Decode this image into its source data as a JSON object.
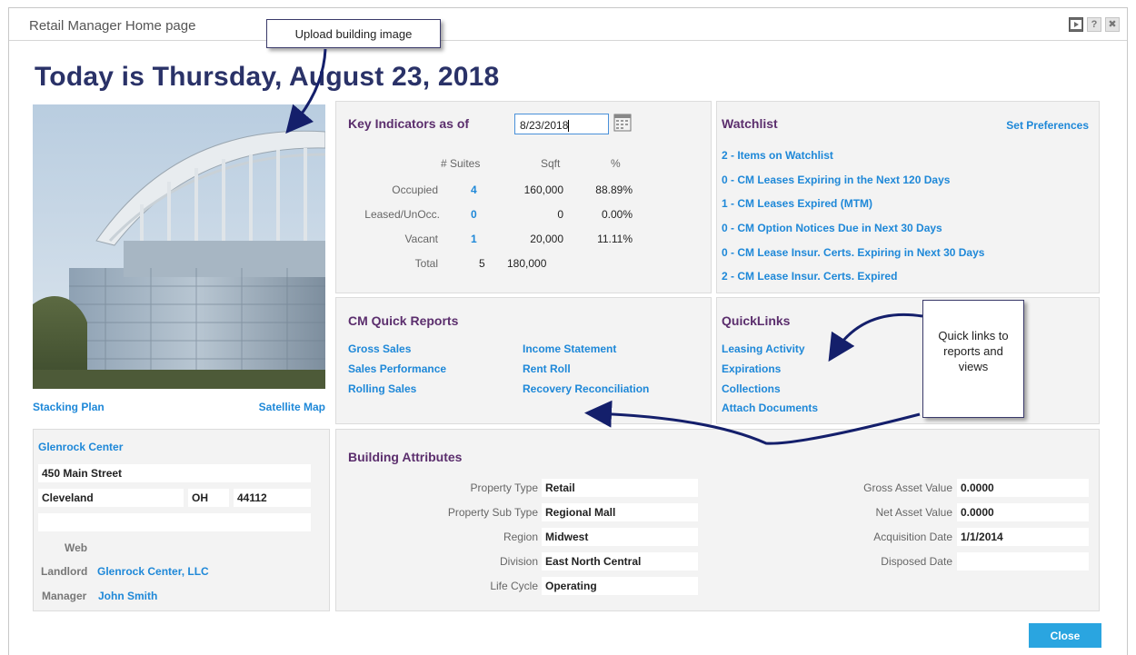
{
  "window": {
    "title": "Retail Manager Home page"
  },
  "heading": "Today is Thursday, August 23, 2018",
  "image_links": {
    "stacking_plan": "Stacking Plan",
    "satellite_map": "Satellite Map"
  },
  "key_indicators": {
    "title": "Key Indicators as of",
    "date_value": "8/23/2018",
    "columns": [
      "# Suites",
      "Sqft",
      "%"
    ],
    "rows": [
      {
        "label": "Occupied",
        "suites": "4",
        "sqft": "160,000",
        "pct": "88.89%"
      },
      {
        "label": "Leased/UnOcc.",
        "suites": "0",
        "sqft": "0",
        "pct": "0.00%"
      },
      {
        "label": "Vacant",
        "suites": "1",
        "sqft": "20,000",
        "pct": "11.11%"
      },
      {
        "label": "Total",
        "suites": "5",
        "sqft": "180,000",
        "pct": ""
      }
    ]
  },
  "watchlist": {
    "title": "Watchlist",
    "set_preferences": "Set Preferences",
    "items": [
      "2 - Items on Watchlist",
      "0 - CM Leases Expiring in the Next 120 Days",
      "1 - CM Leases Expired (MTM)",
      "0 - CM Option Notices Due in Next 30 Days",
      "0 - CM Lease Insur. Certs. Expiring in Next 30 Days",
      "2 - CM Lease Insur. Certs. Expired"
    ]
  },
  "quick_reports": {
    "title": "CM Quick Reports",
    "left": [
      "Gross Sales",
      "Sales Performance",
      "Rolling Sales"
    ],
    "right": [
      "Income Statement",
      "Rent Roll",
      "Recovery Reconciliation"
    ]
  },
  "quicklinks": {
    "title": "QuickLinks",
    "items": [
      "Leasing Activity",
      "Expirations",
      "Collections",
      "Attach Documents"
    ]
  },
  "property": {
    "name": "Glenrock Center",
    "address1": "450 Main Street",
    "city": "Cleveland",
    "state": "OH",
    "zip": "44112",
    "web_label": "Web",
    "landlord_label": "Landlord",
    "landlord": "Glenrock Center, LLC",
    "manager_label": "Manager",
    "manager": "John Smith"
  },
  "building_attributes": {
    "title": "Building Attributes",
    "left": [
      {
        "label": "Property Type",
        "value": "Retail"
      },
      {
        "label": "Property Sub Type",
        "value": "Regional Mall"
      },
      {
        "label": "Region",
        "value": "Midwest"
      },
      {
        "label": "Division",
        "value": "East North Central"
      },
      {
        "label": "Life Cycle",
        "value": "Operating"
      }
    ],
    "right": [
      {
        "label": "Gross Asset Value",
        "value": "0.0000"
      },
      {
        "label": "Net Asset Value",
        "value": "0.0000"
      },
      {
        "label": "Acquisition Date",
        "value": "1/1/2014"
      },
      {
        "label": "Disposed Date",
        "value": ""
      }
    ]
  },
  "callouts": {
    "upload": "Upload building image",
    "quicklinks": "Quick links to reports and views"
  },
  "close_label": "Close",
  "colors": {
    "heading": "#2a3268",
    "link": "#1e88d8",
    "panel_title": "#5b2e6d",
    "close": "#2aa5e0"
  },
  "icons": [
    "video-icon",
    "help-icon",
    "close-icon",
    "calendar-icon"
  ]
}
